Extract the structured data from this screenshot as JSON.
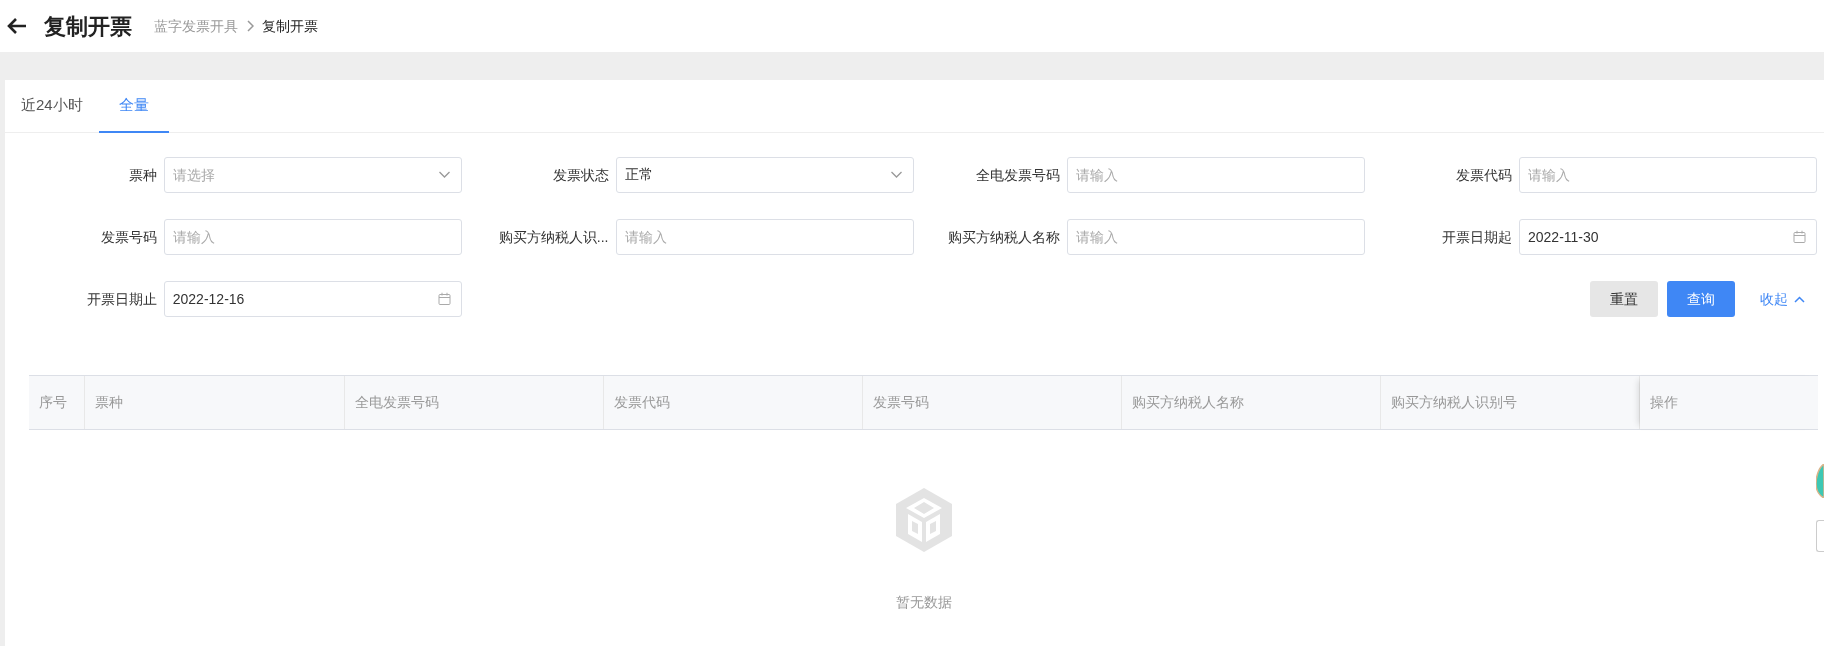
{
  "header": {
    "title": "复制开票",
    "breadcrumb": [
      {
        "label": "蓝字发票开具",
        "current": false
      },
      {
        "label": "复制开票",
        "current": true
      }
    ]
  },
  "tabs": [
    {
      "label": "近24小时",
      "selected": false
    },
    {
      "label": "全量",
      "selected": true
    }
  ],
  "filters": [
    {
      "label": "票种",
      "kind": "select",
      "placeholder": "请选择"
    },
    {
      "label": "发票状态",
      "kind": "select",
      "value": "正常"
    },
    {
      "label": "全电发票号码",
      "kind": "input",
      "placeholder": "请输入"
    },
    {
      "label": "发票代码",
      "kind": "input",
      "placeholder": "请输入"
    },
    {
      "label": "发票号码",
      "kind": "input",
      "placeholder": "请输入"
    },
    {
      "label": "购买方纳税人识...",
      "kind": "input",
      "placeholder": "请输入"
    },
    {
      "label": "购买方纳税人名称",
      "kind": "input",
      "placeholder": "请输入"
    },
    {
      "label": "开票日期起",
      "kind": "date",
      "value": "2022-11-30"
    },
    {
      "label": "开票日期止",
      "kind": "date",
      "value": "2022-12-16"
    }
  ],
  "actions": {
    "reset": "重置",
    "search": "查询",
    "collapse": "收起"
  },
  "table": {
    "columns": [
      "序号",
      "票种",
      "全电发票号码",
      "发票代码",
      "发票号码",
      "购买方纳税人名称",
      "购买方纳税人识别号",
      "操作"
    ],
    "empty_text": "暂无数据"
  }
}
